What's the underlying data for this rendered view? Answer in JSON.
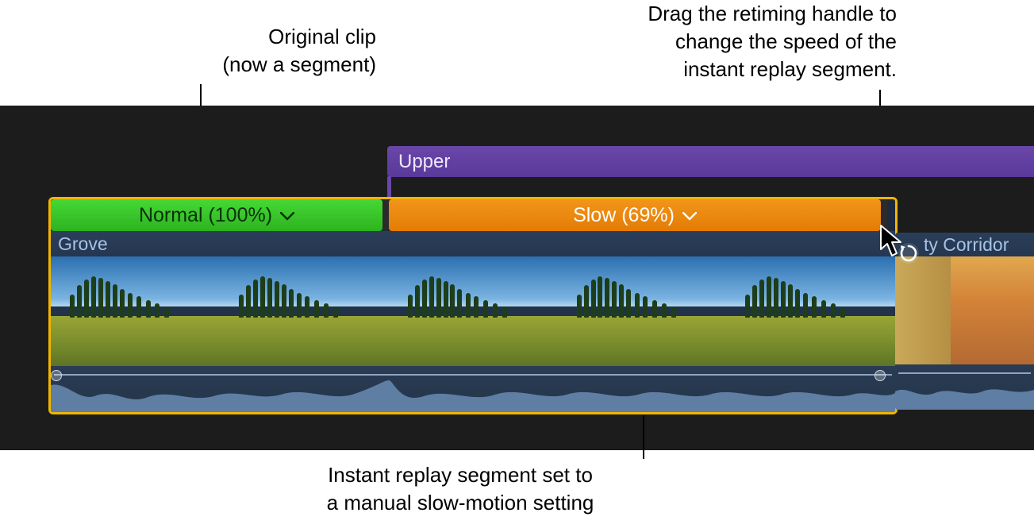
{
  "annotations": {
    "original_clip": "Original clip\n(now a segment)",
    "retiming_handle": "Drag the retiming handle to\nchange the speed of the\ninstant replay segment.",
    "instant_replay": "Instant replay segment set to\na manual slow-motion setting"
  },
  "timeline": {
    "upper_clip_label": "Upper",
    "main_clip": {
      "name": "Grove",
      "segments": {
        "normal": {
          "label": "Normal (100%)"
        },
        "slow": {
          "label": "Slow (69%)"
        }
      }
    },
    "next_clip": {
      "name_visible": "ty Corridor"
    }
  },
  "icons": {
    "chevron": "chevron-down-icon",
    "replay": "instant-replay-icon",
    "cursor": "pointer-cursor-icon"
  },
  "colors": {
    "selection": "#f0b500",
    "normal_segment": "#2db31f",
    "slow_segment": "#e37c05",
    "upper_track": "#59399a"
  }
}
